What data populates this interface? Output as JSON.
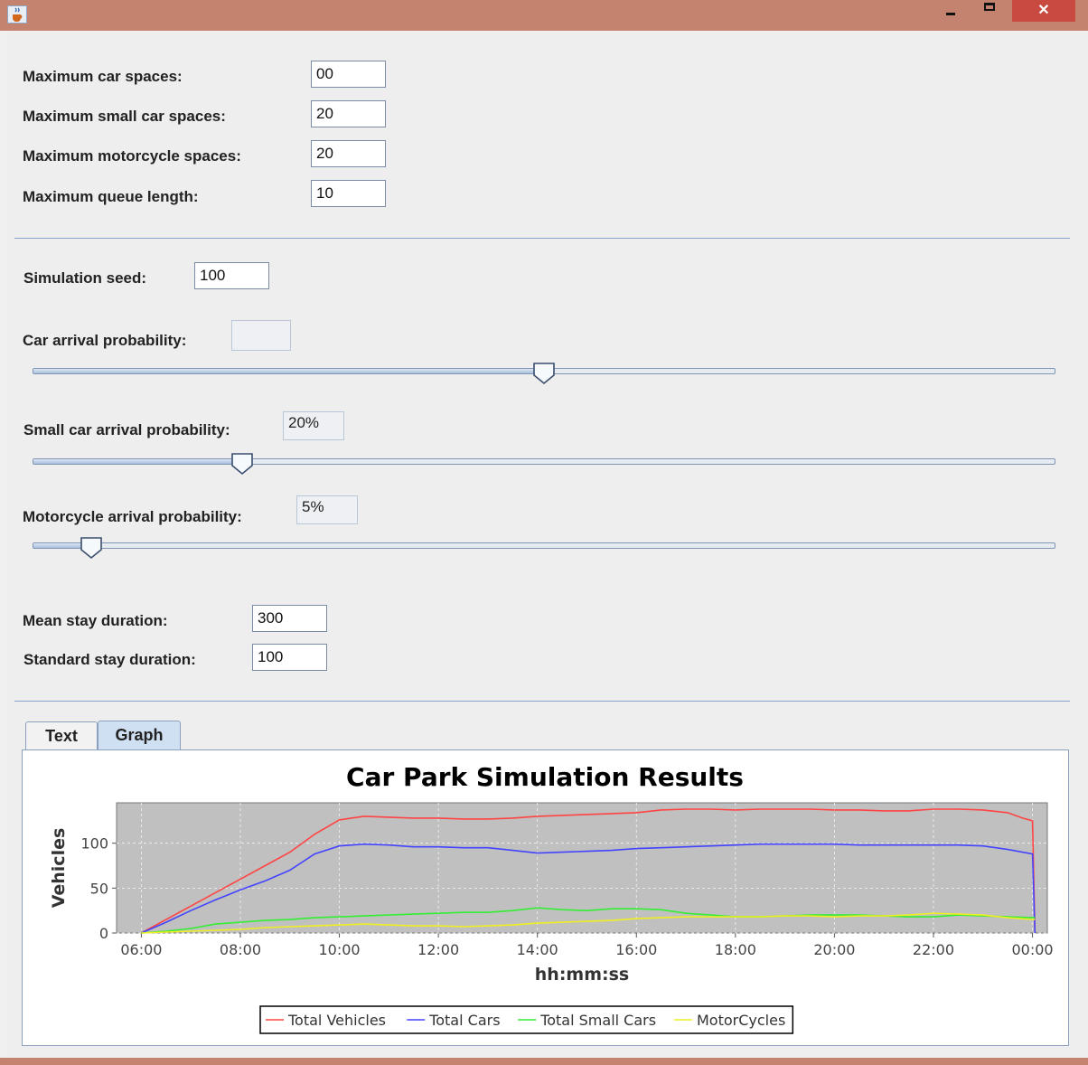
{
  "form": {
    "max_car_spaces_label": "Maximum car spaces:",
    "max_car_spaces_value": "00",
    "max_small_car_spaces_label": "Maximum small car spaces:",
    "max_small_car_spaces_value": "20",
    "max_motorcycle_spaces_label": "Maximum motorcycle spaces:",
    "max_motorcycle_spaces_value": "20",
    "max_queue_length_label": "Maximum queue length:",
    "max_queue_length_value": "10",
    "simulation_seed_label": "Simulation seed:",
    "simulation_seed_value": "100",
    "car_arrival_label": "Car arrival probability:",
    "car_arrival_value": "",
    "car_arrival_slider_fraction": 0.5,
    "small_car_arrival_label": "Small car arrival probability:",
    "small_car_arrival_value": "20%",
    "small_car_arrival_slider_fraction": 0.2,
    "motorcycle_arrival_label": "Motorcycle arrival probability:",
    "motorcycle_arrival_value": "5%",
    "motorcycle_arrival_slider_fraction": 0.05,
    "mean_stay_label": "Mean stay duration:",
    "mean_stay_value": "300",
    "std_stay_label": "Standard stay duration:",
    "std_stay_value": "100"
  },
  "tabs": [
    {
      "label": "Text",
      "selected": false
    },
    {
      "label": "Graph",
      "selected": true
    }
  ],
  "icons": {
    "app": "java-cup-icon",
    "minimize": "minimize-icon",
    "maximize": "maximize-icon",
    "close": "close-icon"
  },
  "colors": {
    "title_bar": "#c3836f",
    "close_button": "#c94a40",
    "plot_background": "#c0c0c0"
  },
  "chart_data": {
    "type": "line",
    "title": "Car Park Simulation Results",
    "xlabel": "hh:mm:ss",
    "ylabel": "Vehicles",
    "x_ticks": [
      "06:00",
      "08:00",
      "10:00",
      "12:00",
      "14:00",
      "16:00",
      "18:00",
      "20:00",
      "22:00",
      "00:00"
    ],
    "y_ticks": [
      0,
      50,
      100
    ],
    "ylim": [
      0,
      145
    ],
    "xlim_hours": [
      5.5,
      24.3
    ],
    "grid": true,
    "legend_position": "bottom",
    "series": [
      {
        "name": "Total Vehicles",
        "color": "#ff4444",
        "points": [
          [
            6,
            0
          ],
          [
            6.5,
            15
          ],
          [
            7,
            30
          ],
          [
            7.5,
            45
          ],
          [
            8,
            60
          ],
          [
            8.5,
            75
          ],
          [
            9,
            90
          ],
          [
            9.5,
            110
          ],
          [
            10,
            126
          ],
          [
            10.5,
            130
          ],
          [
            11,
            129
          ],
          [
            11.5,
            128
          ],
          [
            12,
            128
          ],
          [
            12.5,
            127
          ],
          [
            13,
            127
          ],
          [
            13.5,
            128
          ],
          [
            14,
            130
          ],
          [
            14.5,
            131
          ],
          [
            15,
            132
          ],
          [
            15.5,
            133
          ],
          [
            16,
            134
          ],
          [
            16.5,
            137
          ],
          [
            17,
            138
          ],
          [
            17.5,
            138
          ],
          [
            18,
            137
          ],
          [
            18.5,
            138
          ],
          [
            19,
            138
          ],
          [
            19.5,
            138
          ],
          [
            20,
            137
          ],
          [
            20.5,
            137
          ],
          [
            21,
            136
          ],
          [
            21.5,
            136
          ],
          [
            22,
            138
          ],
          [
            22.5,
            138
          ],
          [
            23,
            137
          ],
          [
            23.5,
            134
          ],
          [
            23.8,
            128
          ],
          [
            24,
            125
          ],
          [
            24.05,
            0
          ]
        ]
      },
      {
        "name": "Total Cars",
        "color": "#4444ff",
        "points": [
          [
            6,
            0
          ],
          [
            6.5,
            12
          ],
          [
            7,
            25
          ],
          [
            7.5,
            37
          ],
          [
            8,
            48
          ],
          [
            8.5,
            58
          ],
          [
            9,
            70
          ],
          [
            9.5,
            88
          ],
          [
            10,
            97
          ],
          [
            10.5,
            99
          ],
          [
            11,
            98
          ],
          [
            11.5,
            96
          ],
          [
            12,
            96
          ],
          [
            12.5,
            95
          ],
          [
            13,
            95
          ],
          [
            13.5,
            92
          ],
          [
            14,
            89
          ],
          [
            14.5,
            90
          ],
          [
            15,
            91
          ],
          [
            15.5,
            92
          ],
          [
            16,
            94
          ],
          [
            16.5,
            95
          ],
          [
            17,
            96
          ],
          [
            17.5,
            97
          ],
          [
            18,
            98
          ],
          [
            18.5,
            99
          ],
          [
            19,
            99
          ],
          [
            19.5,
            99
          ],
          [
            20,
            99
          ],
          [
            20.5,
            98
          ],
          [
            21,
            98
          ],
          [
            21.5,
            98
          ],
          [
            22,
            98
          ],
          [
            22.5,
            98
          ],
          [
            23,
            97
          ],
          [
            23.5,
            93
          ],
          [
            24,
            88
          ],
          [
            24.05,
            0
          ]
        ]
      },
      {
        "name": "Total Small Cars",
        "color": "#33ee33",
        "points": [
          [
            6,
            0
          ],
          [
            6.5,
            2
          ],
          [
            7,
            5
          ],
          [
            7.5,
            10
          ],
          [
            8,
            12
          ],
          [
            8.5,
            14
          ],
          [
            9,
            15
          ],
          [
            9.5,
            17
          ],
          [
            10,
            18
          ],
          [
            10.5,
            19
          ],
          [
            11,
            20
          ],
          [
            11.5,
            21
          ],
          [
            12,
            22
          ],
          [
            12.5,
            23
          ],
          [
            13,
            23
          ],
          [
            13.5,
            25
          ],
          [
            14,
            28
          ],
          [
            14.5,
            26
          ],
          [
            15,
            25
          ],
          [
            15.5,
            27
          ],
          [
            16,
            27
          ],
          [
            16.5,
            26
          ],
          [
            17,
            22
          ],
          [
            17.5,
            20
          ],
          [
            18,
            18
          ],
          [
            18.5,
            18
          ],
          [
            19,
            19
          ],
          [
            19.5,
            20
          ],
          [
            20,
            20
          ],
          [
            20.5,
            20
          ],
          [
            21,
            19
          ],
          [
            21.5,
            18
          ],
          [
            22,
            18
          ],
          [
            22.5,
            20
          ],
          [
            23,
            19
          ],
          [
            23.5,
            18
          ],
          [
            24,
            17
          ],
          [
            24.05,
            17
          ]
        ]
      },
      {
        "name": "MotorCycles",
        "color": "#eeee22",
        "points": [
          [
            6,
            0
          ],
          [
            6.5,
            1
          ],
          [
            7,
            2
          ],
          [
            7.5,
            3
          ],
          [
            8,
            4
          ],
          [
            8.5,
            6
          ],
          [
            9,
            7
          ],
          [
            9.5,
            8
          ],
          [
            10,
            9
          ],
          [
            10.5,
            10
          ],
          [
            11,
            9
          ],
          [
            11.5,
            8
          ],
          [
            12,
            8
          ],
          [
            12.5,
            7
          ],
          [
            13,
            8
          ],
          [
            13.5,
            9
          ],
          [
            14,
            11
          ],
          [
            14.5,
            12
          ],
          [
            15,
            13
          ],
          [
            15.5,
            14
          ],
          [
            16,
            16
          ],
          [
            16.5,
            17
          ],
          [
            17,
            18
          ],
          [
            17.5,
            18
          ],
          [
            18,
            18
          ],
          [
            18.5,
            18
          ],
          [
            19,
            19
          ],
          [
            19.5,
            19
          ],
          [
            20,
            18
          ],
          [
            20.5,
            19
          ],
          [
            21,
            19
          ],
          [
            21.5,
            20
          ],
          [
            22,
            22
          ],
          [
            22.5,
            21
          ],
          [
            23,
            20
          ],
          [
            23.5,
            17
          ],
          [
            24,
            15
          ],
          [
            24.05,
            15
          ]
        ]
      }
    ]
  }
}
